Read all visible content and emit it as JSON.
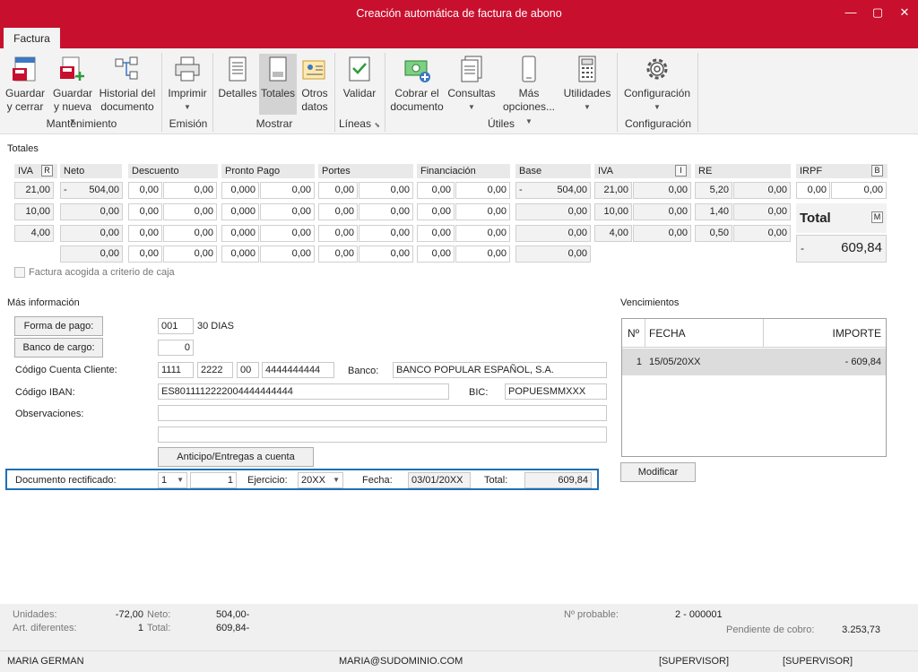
{
  "window": {
    "title": "Creación automática de factura de abono",
    "minimize": "—",
    "maximize": "▢",
    "close": "✕"
  },
  "tab": "Factura",
  "ribbon": {
    "buttons": {
      "guardar_cerrar": [
        "Guardar",
        "y cerrar"
      ],
      "guardar_nueva": [
        "Guardar",
        "y nueva"
      ],
      "historial": [
        "Historial del",
        "documento"
      ],
      "imprimir": "Imprimir",
      "detalles": "Detalles",
      "totales": "Totales",
      "otros_datos": [
        "Otros",
        "datos"
      ],
      "validar": "Validar",
      "cobrar": [
        "Cobrar el",
        "documento"
      ],
      "consultas": "Consultas",
      "mas_opciones": [
        "Más",
        "opciones..."
      ],
      "utilidades": "Utilidades",
      "configuracion": "Configuración"
    },
    "groups": {
      "mantenimiento": "Mantenimiento",
      "emision": "Emisión",
      "mostrar": "Mostrar",
      "lineas": "Líneas",
      "utiles": "Útiles",
      "configuracion": "Configuración"
    }
  },
  "totales": {
    "section_title": "Totales",
    "headers": {
      "iva": "IVA",
      "iva_flag": "R",
      "neto": "Neto",
      "descuento": "Descuento",
      "pronto_pago": "Pronto Pago",
      "portes": "Portes",
      "financiacion": "Financiación",
      "base": "Base",
      "iva2": "IVA",
      "iva2_flag": "I",
      "re": "RE",
      "irpf": "IRPF",
      "irpf_flag": "B"
    },
    "rows": [
      {
        "iva": "21,00",
        "neto_sign": "-",
        "neto": "504,00",
        "d1": "0,00",
        "d2": "0,00",
        "pp1": "0,000",
        "pp2": "0,00",
        "po1": "0,00",
        "po2": "0,00",
        "f1": "0,00",
        "f2": "0,00",
        "base_sign": "-",
        "base": "504,00",
        "iva_pct": "21,00",
        "iva_val": "0,00",
        "re_pct": "5,20",
        "re_val": "0,00"
      },
      {
        "iva": "10,00",
        "neto_sign": "",
        "neto": "0,00",
        "d1": "0,00",
        "d2": "0,00",
        "pp1": "0,000",
        "pp2": "0,00",
        "po1": "0,00",
        "po2": "0,00",
        "f1": "0,00",
        "f2": "0,00",
        "base_sign": "",
        "base": "0,00",
        "iva_pct": "10,00",
        "iva_val": "0,00",
        "re_pct": "1,40",
        "re_val": "0,00"
      },
      {
        "iva": "4,00",
        "neto_sign": "",
        "neto": "0,00",
        "d1": "0,00",
        "d2": "0,00",
        "pp1": "0,000",
        "pp2": "0,00",
        "po1": "0,00",
        "po2": "0,00",
        "f1": "0,00",
        "f2": "0,00",
        "base_sign": "",
        "base": "0,00",
        "iva_pct": "4,00",
        "iva_val": "0,00",
        "re_pct": "0,50",
        "re_val": "0,00"
      },
      {
        "iva": "",
        "neto_sign": "",
        "neto": "0,00",
        "d1": "0,00",
        "d2": "0,00",
        "pp1": "0,000",
        "pp2": "0,00",
        "po1": "0,00",
        "po2": "0,00",
        "f1": "0,00",
        "f2": "0,00",
        "base_sign": "",
        "base": "0,00"
      }
    ],
    "irpf_pct": "0,00",
    "irpf_val": "0,00",
    "total_label": "Total",
    "total_flag": "M",
    "total_sign": "-",
    "total_value": "609,84",
    "criterio_caja": "Factura acogida a criterio de caja"
  },
  "mas_info": {
    "section_title": "Más información",
    "forma_pago_btn": "Forma de pago:",
    "forma_pago_code": "001",
    "forma_pago_desc": "30 DIAS",
    "banco_cargo_btn": "Banco de cargo:",
    "banco_cargo_val": "0",
    "ccc_label": "Código Cuenta Cliente:",
    "ccc": [
      "1111",
      "2222",
      "00",
      "4444444444"
    ],
    "banco_label": "Banco:",
    "banco_val": "BANCO POPULAR ESPAÑOL, S.A.",
    "iban_label": "Código IBAN:",
    "iban_val": "ES8011112222004444444444",
    "bic_label": "BIC:",
    "bic_val": "POPUESMMXXX",
    "obs_label": "Observaciones:",
    "anticipo_btn": "Anticipo/Entregas a cuenta",
    "doc_rect_label": "Documento rectificado:",
    "doc_rect_serie": "1",
    "doc_rect_num": "1",
    "ejercicio_label": "Ejercicio:",
    "ejercicio_val": "20XX",
    "fecha_label": "Fecha:",
    "fecha_val": "03/01/20XX",
    "total_label": "Total:",
    "total_val": "609,84"
  },
  "vencimientos": {
    "title": "Vencimientos",
    "headers": {
      "n": "Nº",
      "fecha": "FECHA",
      "importe": "IMPORTE"
    },
    "rows": [
      {
        "n": "1",
        "fecha": "15/05/20XX",
        "importe": "- 609,84"
      }
    ],
    "modificar_btn": "Modificar"
  },
  "footer": {
    "unidades_label": "Unidades:",
    "unidades_val": "-72,00",
    "art_label": "Art. diferentes:",
    "art_val": "1",
    "neto_label": "Neto:",
    "neto_val": "504,00-",
    "total_label": "Total:",
    "total_val": "609,84-",
    "n_probable_label": "Nº probable:",
    "n_probable_val": "2 - 000001",
    "pendiente_label": "Pendiente de cobro:",
    "pendiente_val": "3.253,73",
    "status": [
      "MARIA GERMAN",
      "MARIA@SUDOMINIO.COM",
      "[SUPERVISOR]",
      "[SUPERVISOR]"
    ]
  }
}
